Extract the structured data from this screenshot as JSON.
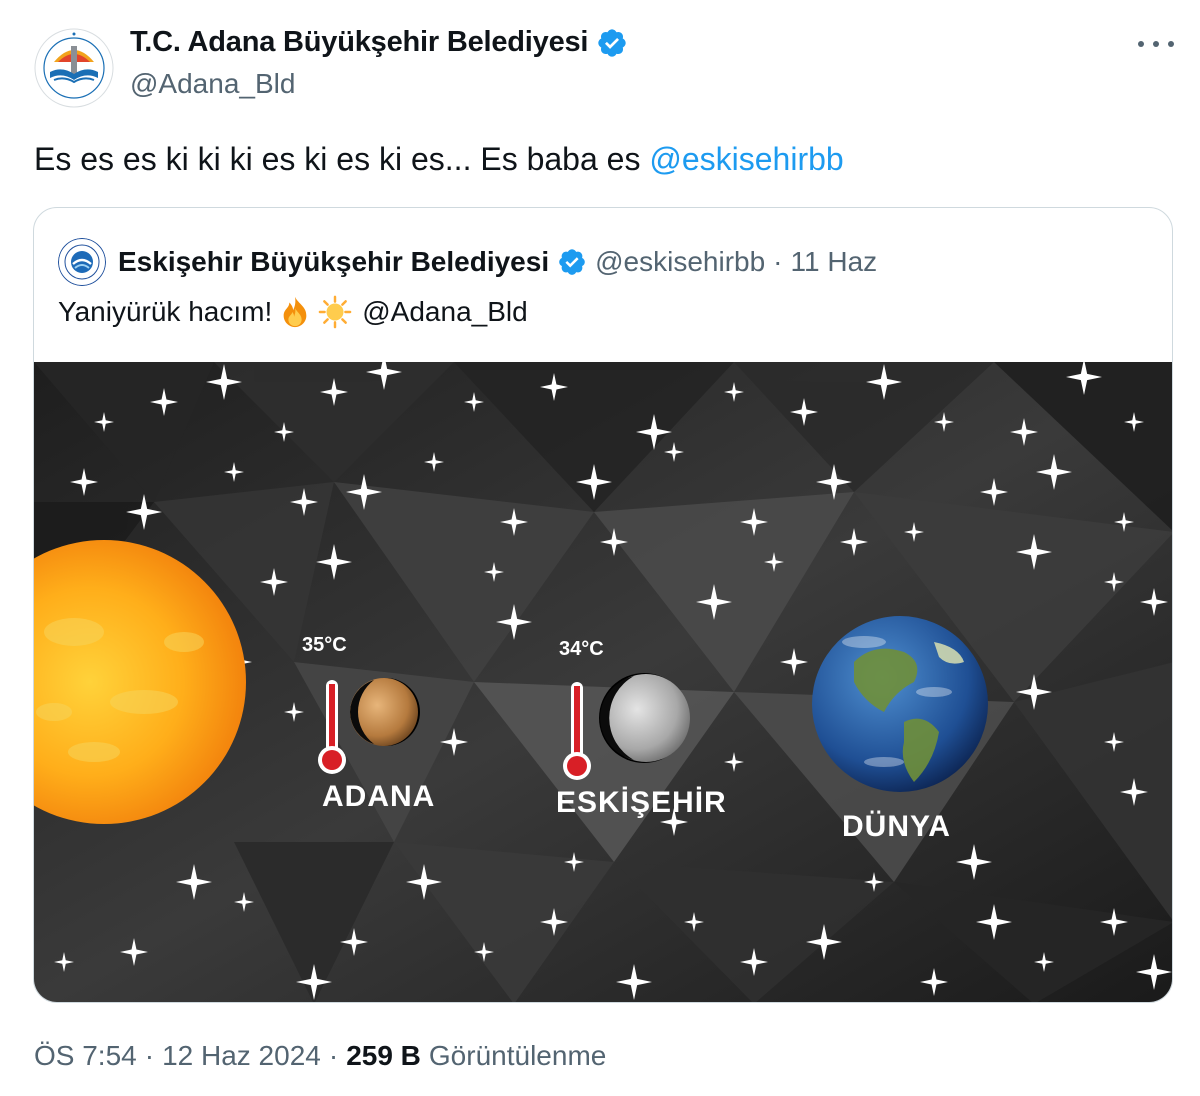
{
  "tweet": {
    "author_name": "T.C. Adana Büyükşehir Belediyesi",
    "author_handle": "@Adana_Bld",
    "text_plain": "Es es es ki ki ki es ki es ki es... Es baba es ",
    "text_mention": "@eskisehirbb",
    "time": "ÖS 7:54",
    "separator": "·",
    "date": "12 Haz 2024",
    "views_count": "259 B",
    "views_label": "Görüntülenme",
    "verified_color": "#1d9bf0"
  },
  "quote": {
    "author_name": "Eskişehir Büyükşehir Belediyesi",
    "author_handle": "@eskisehirbb",
    "separator": "·",
    "date": "11 Haz",
    "text": "Yaniyürük hacım!",
    "emojis": [
      "fire-emoji",
      "sun-emoji"
    ],
    "mention": "@Adana_Bld"
  },
  "image": {
    "labels": {
      "adana": "ADANA",
      "eskisehir": "ESKİŞEHİR",
      "dunya": "DÜNYA"
    },
    "temps": {
      "adana": "35°C",
      "eskisehir": "34°C"
    }
  },
  "icons": {
    "verified": "verified-badge-icon",
    "more": "more-options-icon",
    "thermometer": "thermometer-icon"
  }
}
